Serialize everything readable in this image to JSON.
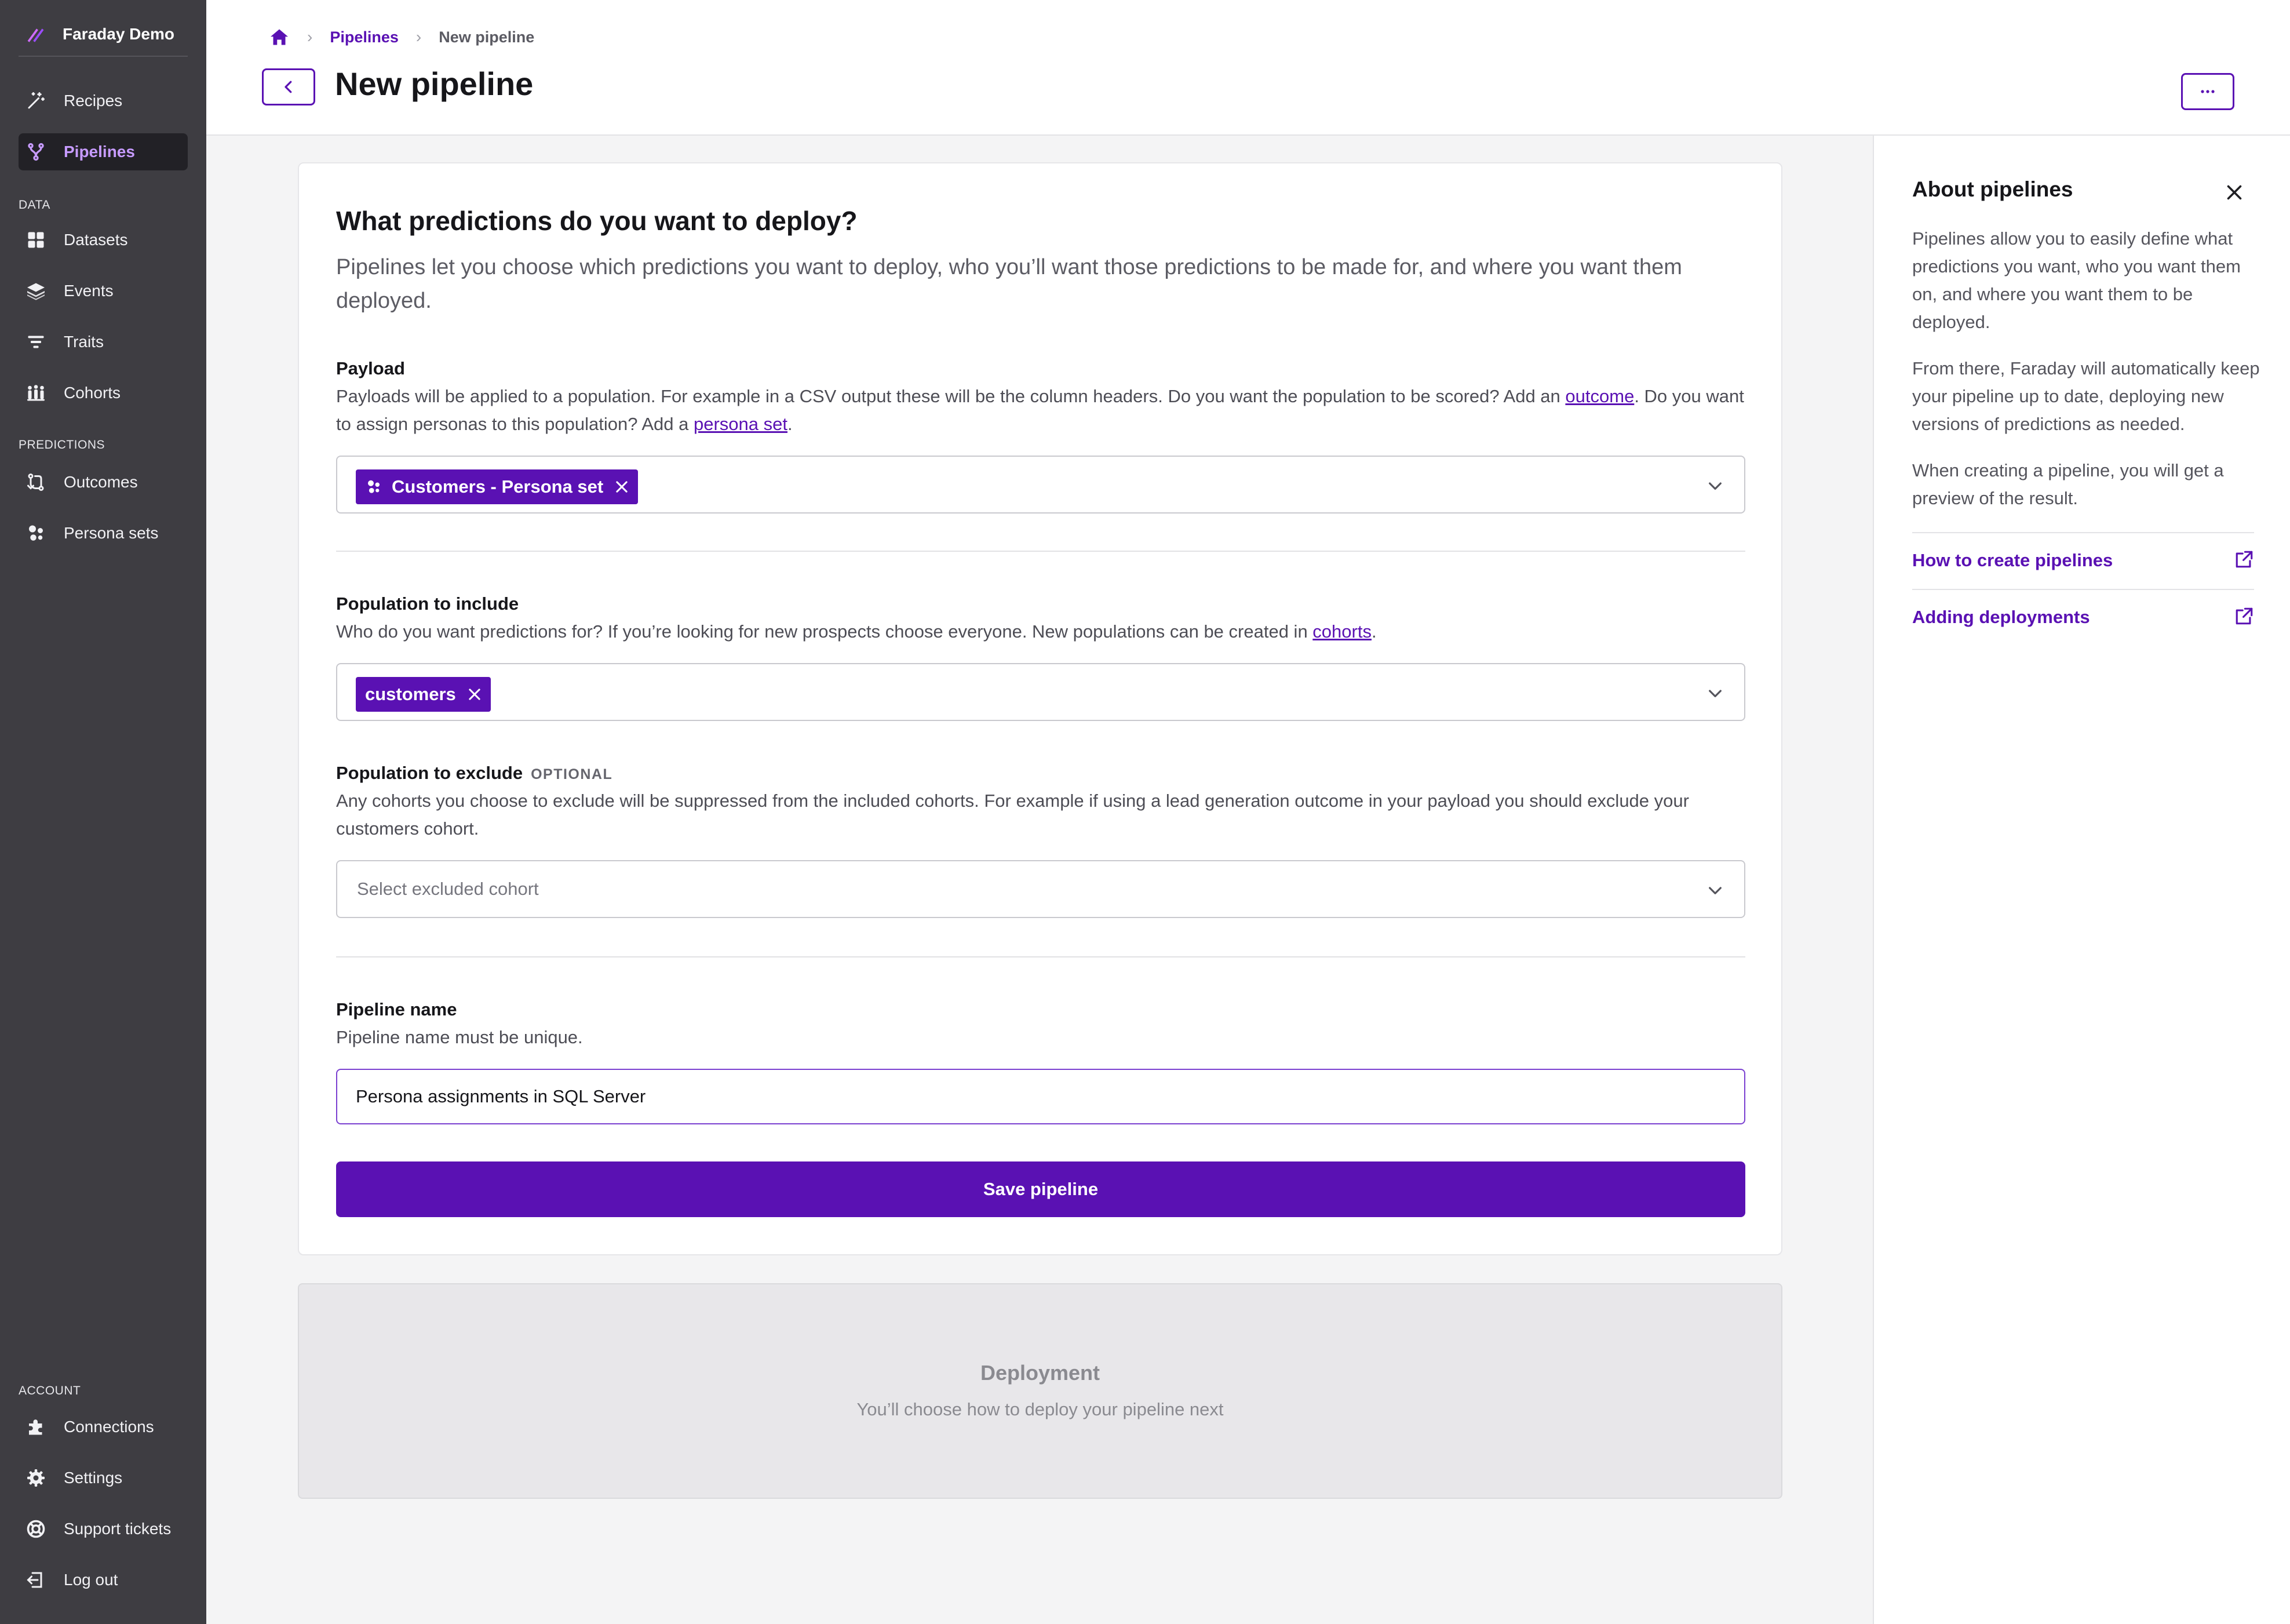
{
  "colors": {
    "accent": "#5a11b3",
    "sidebar_bg": "#3e3d42",
    "sidebar_active_text": "#c79bff"
  },
  "sidebar": {
    "brand": "Faraday Demo",
    "items": [
      {
        "label": "Recipes",
        "icon": "magic-wand-icon"
      },
      {
        "label": "Pipelines",
        "icon": "pipeline-branch-icon",
        "active": true
      }
    ],
    "data_section": "DATA",
    "data_items": [
      {
        "label": "Datasets",
        "icon": "grid-icon"
      },
      {
        "label": "Events",
        "icon": "layers-icon"
      },
      {
        "label": "Traits",
        "icon": "filter-icon"
      },
      {
        "label": "Cohorts",
        "icon": "people-icon"
      }
    ],
    "predictions_section": "PREDICTIONS",
    "predictions_items": [
      {
        "label": "Outcomes",
        "icon": "outcome-icon"
      },
      {
        "label": "Persona sets",
        "icon": "persona-icon"
      }
    ],
    "account_section": "ACCOUNT",
    "account_items": [
      {
        "label": "Connections",
        "icon": "puzzle-icon"
      },
      {
        "label": "Settings",
        "icon": "gear-icon"
      },
      {
        "label": "Support tickets",
        "icon": "lifebuoy-icon"
      },
      {
        "label": "Log out",
        "icon": "logout-icon"
      }
    ]
  },
  "header": {
    "breadcrumb": {
      "parent": "Pipelines",
      "current": "New pipeline"
    },
    "title": "New pipeline",
    "more_label": "···"
  },
  "form": {
    "title": "What predictions do you want to deploy?",
    "intro": "Pipelines let you choose which predictions you want to deploy, who you’ll want those predictions to be made for, and where you want them deployed.",
    "payload": {
      "label": "Payload",
      "help_1": "Payloads will be applied to a population. For example in a CSV output these will be the column headers. Do you want the population to be scored? Add an ",
      "link_outcome": "outcome",
      "help_2": ". Do you want to assign personas to this population? Add a ",
      "link_persona": "persona set",
      "help_3": ".",
      "chip": "Customers - Persona set"
    },
    "include": {
      "label": "Population to include",
      "help_1": "Who do you want predictions for? If you’re looking for new prospects choose everyone. New populations can be created in ",
      "link_cohorts": "cohorts",
      "help_2": ".",
      "chip": "customers"
    },
    "exclude": {
      "label": "Population to exclude",
      "optional": "OPTIONAL",
      "help": "Any cohorts you choose to exclude will be suppressed from the included cohorts. For example if using a lead generation outcome in your payload you should exclude your customers cohort.",
      "placeholder": "Select excluded cohort"
    },
    "name": {
      "label": "Pipeline name",
      "help": "Pipeline name must be unique.",
      "value": "Persona assignments in SQL Server"
    },
    "save_label": "Save pipeline"
  },
  "deployment": {
    "title": "Deployment",
    "subtitle": "You’ll choose how to deploy your pipeline next"
  },
  "about": {
    "title": "About pipelines",
    "p1": "Pipelines allow you to easily define what predictions you want, who you want them on, and where you want them to be deployed.",
    "p2": "From there, Faraday will automatically keep your pipeline up to date, deploying new versions of predictions as needed.",
    "p3": "When creating a pipeline, you will get a preview of the result.",
    "links": [
      "How to create pipelines",
      "Adding deployments"
    ]
  }
}
